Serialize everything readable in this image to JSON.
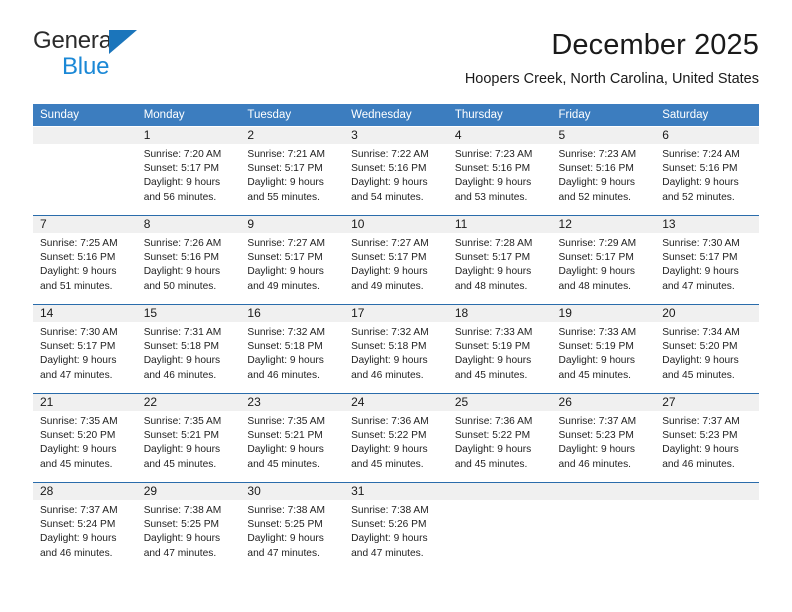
{
  "brand": {
    "name_top": "General",
    "name_bottom": "Blue",
    "triangle_color": "#1b75bb",
    "bottom_color": "#1b88d6"
  },
  "header": {
    "title": "December 2025",
    "subtitle": "Hoopers Creek, North Carolina, United States"
  },
  "theme": {
    "header_band": "#3c7dbf",
    "daynum_band": "#f0f0f0",
    "week_separator": "#2a6cab"
  },
  "weekday_headers": [
    "Sunday",
    "Monday",
    "Tuesday",
    "Wednesday",
    "Thursday",
    "Friday",
    "Saturday"
  ],
  "labels": {
    "sunrise_prefix": "Sunrise:",
    "sunset_prefix": "Sunset:",
    "daylight_prefix": "Daylight:"
  },
  "weeks": [
    [
      {
        "day": "",
        "sunrise": "",
        "sunset": "",
        "daylight_line1": "",
        "daylight_line2": ""
      },
      {
        "day": "1",
        "sunrise": "Sunrise: 7:20 AM",
        "sunset": "Sunset: 5:17 PM",
        "daylight_line1": "Daylight: 9 hours",
        "daylight_line2": "and 56 minutes."
      },
      {
        "day": "2",
        "sunrise": "Sunrise: 7:21 AM",
        "sunset": "Sunset: 5:17 PM",
        "daylight_line1": "Daylight: 9 hours",
        "daylight_line2": "and 55 minutes."
      },
      {
        "day": "3",
        "sunrise": "Sunrise: 7:22 AM",
        "sunset": "Sunset: 5:16 PM",
        "daylight_line1": "Daylight: 9 hours",
        "daylight_line2": "and 54 minutes."
      },
      {
        "day": "4",
        "sunrise": "Sunrise: 7:23 AM",
        "sunset": "Sunset: 5:16 PM",
        "daylight_line1": "Daylight: 9 hours",
        "daylight_line2": "and 53 minutes."
      },
      {
        "day": "5",
        "sunrise": "Sunrise: 7:23 AM",
        "sunset": "Sunset: 5:16 PM",
        "daylight_line1": "Daylight: 9 hours",
        "daylight_line2": "and 52 minutes."
      },
      {
        "day": "6",
        "sunrise": "Sunrise: 7:24 AM",
        "sunset": "Sunset: 5:16 PM",
        "daylight_line1": "Daylight: 9 hours",
        "daylight_line2": "and 52 minutes."
      }
    ],
    [
      {
        "day": "7",
        "sunrise": "Sunrise: 7:25 AM",
        "sunset": "Sunset: 5:16 PM",
        "daylight_line1": "Daylight: 9 hours",
        "daylight_line2": "and 51 minutes."
      },
      {
        "day": "8",
        "sunrise": "Sunrise: 7:26 AM",
        "sunset": "Sunset: 5:16 PM",
        "daylight_line1": "Daylight: 9 hours",
        "daylight_line2": "and 50 minutes."
      },
      {
        "day": "9",
        "sunrise": "Sunrise: 7:27 AM",
        "sunset": "Sunset: 5:17 PM",
        "daylight_line1": "Daylight: 9 hours",
        "daylight_line2": "and 49 minutes."
      },
      {
        "day": "10",
        "sunrise": "Sunrise: 7:27 AM",
        "sunset": "Sunset: 5:17 PM",
        "daylight_line1": "Daylight: 9 hours",
        "daylight_line2": "and 49 minutes."
      },
      {
        "day": "11",
        "sunrise": "Sunrise: 7:28 AM",
        "sunset": "Sunset: 5:17 PM",
        "daylight_line1": "Daylight: 9 hours",
        "daylight_line2": "and 48 minutes."
      },
      {
        "day": "12",
        "sunrise": "Sunrise: 7:29 AM",
        "sunset": "Sunset: 5:17 PM",
        "daylight_line1": "Daylight: 9 hours",
        "daylight_line2": "and 48 minutes."
      },
      {
        "day": "13",
        "sunrise": "Sunrise: 7:30 AM",
        "sunset": "Sunset: 5:17 PM",
        "daylight_line1": "Daylight: 9 hours",
        "daylight_line2": "and 47 minutes."
      }
    ],
    [
      {
        "day": "14",
        "sunrise": "Sunrise: 7:30 AM",
        "sunset": "Sunset: 5:17 PM",
        "daylight_line1": "Daylight: 9 hours",
        "daylight_line2": "and 47 minutes."
      },
      {
        "day": "15",
        "sunrise": "Sunrise: 7:31 AM",
        "sunset": "Sunset: 5:18 PM",
        "daylight_line1": "Daylight: 9 hours",
        "daylight_line2": "and 46 minutes."
      },
      {
        "day": "16",
        "sunrise": "Sunrise: 7:32 AM",
        "sunset": "Sunset: 5:18 PM",
        "daylight_line1": "Daylight: 9 hours",
        "daylight_line2": "and 46 minutes."
      },
      {
        "day": "17",
        "sunrise": "Sunrise: 7:32 AM",
        "sunset": "Sunset: 5:18 PM",
        "daylight_line1": "Daylight: 9 hours",
        "daylight_line2": "and 46 minutes."
      },
      {
        "day": "18",
        "sunrise": "Sunrise: 7:33 AM",
        "sunset": "Sunset: 5:19 PM",
        "daylight_line1": "Daylight: 9 hours",
        "daylight_line2": "and 45 minutes."
      },
      {
        "day": "19",
        "sunrise": "Sunrise: 7:33 AM",
        "sunset": "Sunset: 5:19 PM",
        "daylight_line1": "Daylight: 9 hours",
        "daylight_line2": "and 45 minutes."
      },
      {
        "day": "20",
        "sunrise": "Sunrise: 7:34 AM",
        "sunset": "Sunset: 5:20 PM",
        "daylight_line1": "Daylight: 9 hours",
        "daylight_line2": "and 45 minutes."
      }
    ],
    [
      {
        "day": "21",
        "sunrise": "Sunrise: 7:35 AM",
        "sunset": "Sunset: 5:20 PM",
        "daylight_line1": "Daylight: 9 hours",
        "daylight_line2": "and 45 minutes."
      },
      {
        "day": "22",
        "sunrise": "Sunrise: 7:35 AM",
        "sunset": "Sunset: 5:21 PM",
        "daylight_line1": "Daylight: 9 hours",
        "daylight_line2": "and 45 minutes."
      },
      {
        "day": "23",
        "sunrise": "Sunrise: 7:35 AM",
        "sunset": "Sunset: 5:21 PM",
        "daylight_line1": "Daylight: 9 hours",
        "daylight_line2": "and 45 minutes."
      },
      {
        "day": "24",
        "sunrise": "Sunrise: 7:36 AM",
        "sunset": "Sunset: 5:22 PM",
        "daylight_line1": "Daylight: 9 hours",
        "daylight_line2": "and 45 minutes."
      },
      {
        "day": "25",
        "sunrise": "Sunrise: 7:36 AM",
        "sunset": "Sunset: 5:22 PM",
        "daylight_line1": "Daylight: 9 hours",
        "daylight_line2": "and 45 minutes."
      },
      {
        "day": "26",
        "sunrise": "Sunrise: 7:37 AM",
        "sunset": "Sunset: 5:23 PM",
        "daylight_line1": "Daylight: 9 hours",
        "daylight_line2": "and 46 minutes."
      },
      {
        "day": "27",
        "sunrise": "Sunrise: 7:37 AM",
        "sunset": "Sunset: 5:23 PM",
        "daylight_line1": "Daylight: 9 hours",
        "daylight_line2": "and 46 minutes."
      }
    ],
    [
      {
        "day": "28",
        "sunrise": "Sunrise: 7:37 AM",
        "sunset": "Sunset: 5:24 PM",
        "daylight_line1": "Daylight: 9 hours",
        "daylight_line2": "and 46 minutes."
      },
      {
        "day": "29",
        "sunrise": "Sunrise: 7:38 AM",
        "sunset": "Sunset: 5:25 PM",
        "daylight_line1": "Daylight: 9 hours",
        "daylight_line2": "and 47 minutes."
      },
      {
        "day": "30",
        "sunrise": "Sunrise: 7:38 AM",
        "sunset": "Sunset: 5:25 PM",
        "daylight_line1": "Daylight: 9 hours",
        "daylight_line2": "and 47 minutes."
      },
      {
        "day": "31",
        "sunrise": "Sunrise: 7:38 AM",
        "sunset": "Sunset: 5:26 PM",
        "daylight_line1": "Daylight: 9 hours",
        "daylight_line2": "and 47 minutes."
      },
      {
        "day": "",
        "sunrise": "",
        "sunset": "",
        "daylight_line1": "",
        "daylight_line2": ""
      },
      {
        "day": "",
        "sunrise": "",
        "sunset": "",
        "daylight_line1": "",
        "daylight_line2": ""
      },
      {
        "day": "",
        "sunrise": "",
        "sunset": "",
        "daylight_line1": "",
        "daylight_line2": ""
      }
    ]
  ]
}
